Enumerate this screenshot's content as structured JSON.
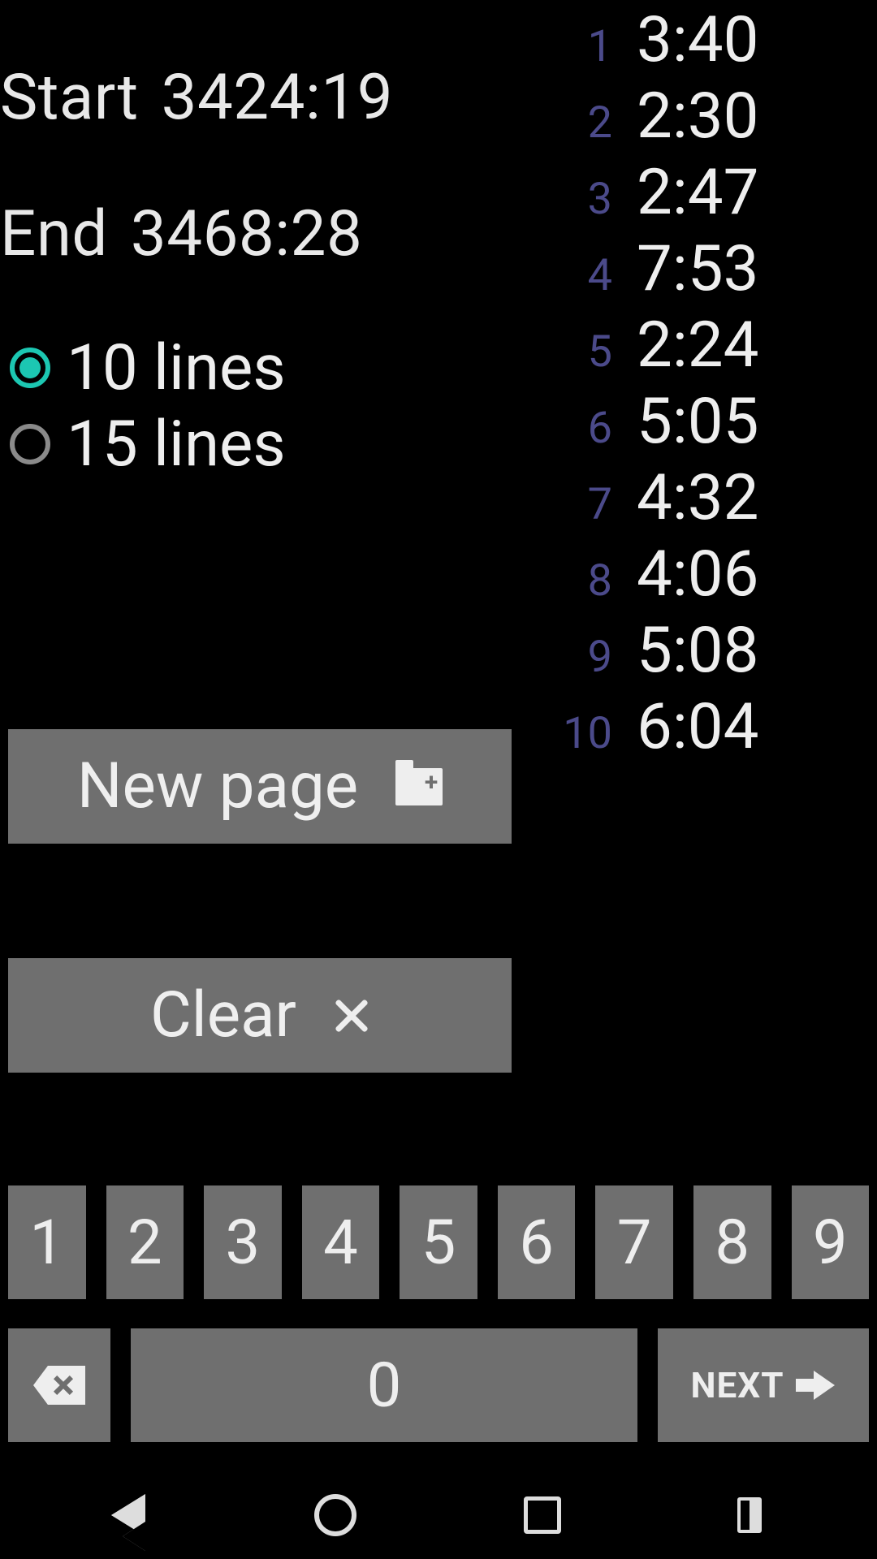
{
  "readouts": {
    "start_label": "Start",
    "start_value": "3424:19",
    "end_label": "End",
    "end_value": "3468:28"
  },
  "radios": {
    "opt1": "10 lines",
    "opt2": "15 lines",
    "selected": "opt1"
  },
  "buttons": {
    "new_page": "New page",
    "clear": "Clear",
    "next": "NEXT"
  },
  "times": [
    {
      "idx": "1",
      "val": "3:40"
    },
    {
      "idx": "2",
      "val": "2:30"
    },
    {
      "idx": "3",
      "val": "2:47"
    },
    {
      "idx": "4",
      "val": "7:53"
    },
    {
      "idx": "5",
      "val": "2:24"
    },
    {
      "idx": "6",
      "val": "5:05"
    },
    {
      "idx": "7",
      "val": "4:32"
    },
    {
      "idx": "8",
      "val": "4:06"
    },
    {
      "idx": "9",
      "val": "5:08"
    },
    {
      "idx": "10",
      "val": "6:04"
    }
  ],
  "keypad": {
    "k1": "1",
    "k2": "2",
    "k3": "3",
    "k4": "4",
    "k5": "5",
    "k6": "6",
    "k7": "7",
    "k8": "8",
    "k9": "9",
    "k0": "0"
  }
}
